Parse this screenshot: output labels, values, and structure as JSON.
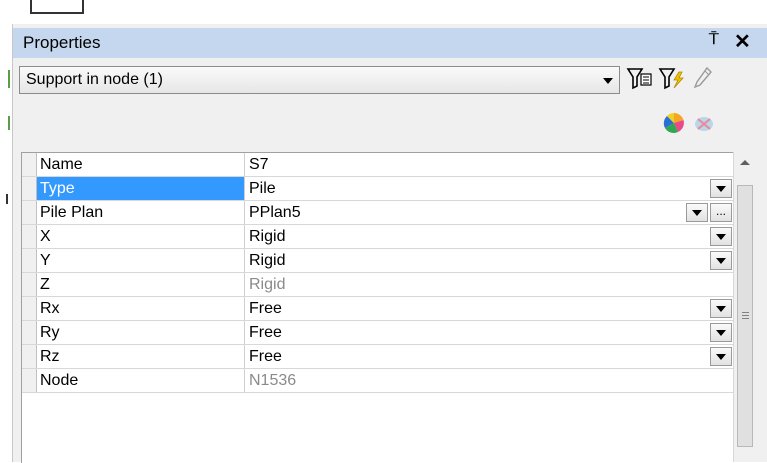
{
  "panel": {
    "title": "Properties",
    "pin_glyph": "⍑",
    "close_glyph": "✕"
  },
  "selector": {
    "value": "Support in node (1)"
  },
  "toolbar": {
    "icons": [
      "filter-icon",
      "filter-lightning-icon",
      "pencil-icon",
      "color-wheel-icon",
      "clear-color-icon"
    ]
  },
  "properties": {
    "rows": [
      {
        "name": "Name",
        "value": "S7"
      },
      {
        "name": "Type",
        "value": "Pile"
      },
      {
        "name": "Pile Plan",
        "value": "PPlan5"
      },
      {
        "name": "X",
        "value": "Rigid"
      },
      {
        "name": "Y",
        "value": "Rigid"
      },
      {
        "name": "Z",
        "value": "Rigid"
      },
      {
        "name": "Rx",
        "value": "Free"
      },
      {
        "name": "Ry",
        "value": "Free"
      },
      {
        "name": "Rz",
        "value": "Free"
      },
      {
        "name": "Node",
        "value": "N1536"
      }
    ],
    "ellipsis": "..."
  },
  "colors": {
    "title_bar": "#c5d7ee",
    "selection": "#3399ff",
    "disabled_text": "#8a8a8a"
  }
}
